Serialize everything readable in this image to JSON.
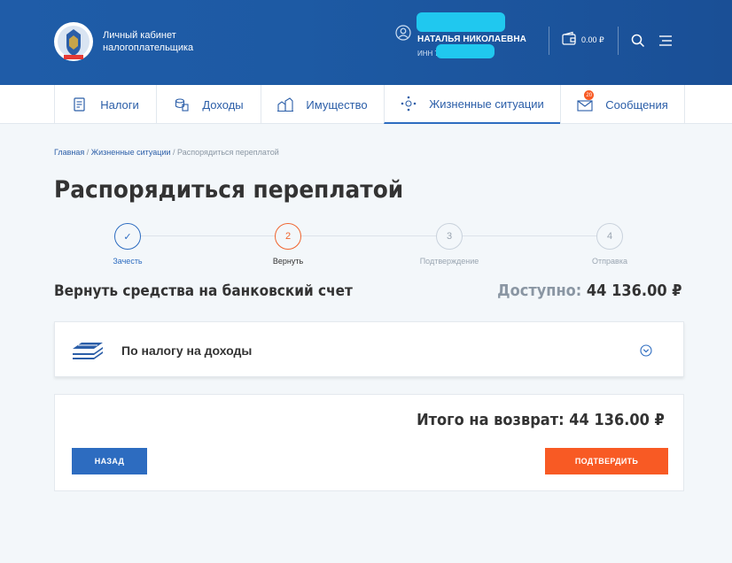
{
  "header": {
    "brand_line1": "Личный кабинет",
    "brand_line2": "налогоплательщика",
    "user_name": "НАТАЛЬЯ НИКОЛАЕВНА",
    "user_inn": "ИНН 7724",
    "balance": "0.00 ₽"
  },
  "nav": {
    "items": [
      {
        "label": "Налоги",
        "icon": "tax-doc-icon"
      },
      {
        "label": "Доходы",
        "icon": "coins-icon"
      },
      {
        "label": "Имущество",
        "icon": "property-icon"
      },
      {
        "label": "Жизненные ситуации",
        "icon": "life-situations-icon"
      },
      {
        "label": "Сообщения",
        "icon": "messages-icon",
        "badge": "20"
      }
    ],
    "active_index": 3
  },
  "breadcrumb": {
    "home": "Главная",
    "section": "Жизненные ситуации",
    "current": "Распорядиться переплатой"
  },
  "page_title": "Распорядиться переплатой",
  "steps": [
    {
      "number": "✓",
      "label": "Зачесть",
      "state": "done"
    },
    {
      "number": "2",
      "label": "Вернуть",
      "state": "current"
    },
    {
      "number": "3",
      "label": "Подтверждение",
      "state": "pending"
    },
    {
      "number": "4",
      "label": "Отправка",
      "state": "pending"
    }
  ],
  "section_title": "Вернуть средства на банковский счет",
  "available": {
    "label": "Доступно:",
    "value": "44 136.00 ₽"
  },
  "tax_item": {
    "label": "По налогу на доходы"
  },
  "total": "Итого на возврат: 44 136.00 ₽",
  "buttons": {
    "back": "НАЗАД",
    "confirm": "ПОДТВЕРДИТЬ"
  },
  "colors": {
    "primary": "#2d6cc0",
    "accent": "#f85a24",
    "header": "#1d5aa4"
  }
}
